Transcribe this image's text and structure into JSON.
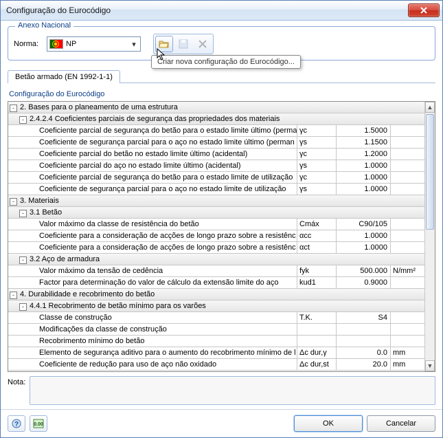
{
  "window": {
    "title": "Configuração do Eurocódigo"
  },
  "annex": {
    "legend": "Anexo Nacional",
    "norm_label": "Norma:",
    "norm_value": "NP",
    "tooltip": "Criar nova configuração do Eurocódigo..."
  },
  "tabs": [
    {
      "label": "Betão armado (EN 1992-1-1)"
    }
  ],
  "tree": {
    "title": "Configuração do Eurocódigo",
    "rows": [
      {
        "type": "section",
        "depth": 0,
        "toggle": "-",
        "label": "2. Bases para o planeamento de uma estrutura"
      },
      {
        "type": "section",
        "depth": 1,
        "toggle": "-",
        "label": "2.4.2.4 Coeficientes parciais de segurança das propriedades dos materiais"
      },
      {
        "type": "value",
        "depth": 2,
        "label": "Coeficiente parcial de segurança do betão para o estado limite último (perma",
        "sym": "γc",
        "val": "1.5000",
        "unit": ""
      },
      {
        "type": "value",
        "depth": 2,
        "label": "Coeficiente de segurança parcial para o aço no estado limite último (perman",
        "sym": "γs",
        "val": "1.1500",
        "unit": ""
      },
      {
        "type": "value",
        "depth": 2,
        "label": "Coeficiente parcial do betão no estado limite último (acidental)",
        "sym": "γc",
        "val": "1.2000",
        "unit": ""
      },
      {
        "type": "value",
        "depth": 2,
        "label": "Coeficiente parcial do aço no estado limite último (acidental)",
        "sym": "γs",
        "val": "1.0000",
        "unit": ""
      },
      {
        "type": "value",
        "depth": 2,
        "label": "Coeficiente parcial de segurança do betão para o estado limite de utilização",
        "sym": "γc",
        "val": "1.0000",
        "unit": ""
      },
      {
        "type": "value",
        "depth": 2,
        "label": "Coeficiente de segurança parcial para o aço no estado limite de utilização",
        "sym": "γs",
        "val": "1.0000",
        "unit": ""
      },
      {
        "type": "section",
        "depth": 0,
        "toggle": "-",
        "label": "3. Materiais"
      },
      {
        "type": "section",
        "depth": 1,
        "toggle": "-",
        "label": "3.1 Betão"
      },
      {
        "type": "value",
        "depth": 2,
        "label": "Valor máximo da classe de resistência do betão",
        "sym": "Cmáx",
        "val": "C90/105",
        "unit": ""
      },
      {
        "type": "value",
        "depth": 2,
        "label": "Coeficiente para a consideração de acções de longo prazo sobre a resistênc",
        "sym": "αcc",
        "val": "1.0000",
        "unit": ""
      },
      {
        "type": "value",
        "depth": 2,
        "label": "Coeficiente para a consideração de acções de longo prazo sobre a resistênc",
        "sym": "αct",
        "val": "1.0000",
        "unit": ""
      },
      {
        "type": "section",
        "depth": 1,
        "toggle": "-",
        "label": "3.2 Aço de armadura"
      },
      {
        "type": "value",
        "depth": 2,
        "label": "Valor máximo da tensão de cedência",
        "sym": "fyk",
        "val": "500.000",
        "unit": "N/mm²"
      },
      {
        "type": "value",
        "depth": 2,
        "label": "Factor para determinação do valor de cálculo da extensão limite do aço",
        "sym": "kud1",
        "val": "0.9000",
        "unit": ""
      },
      {
        "type": "section",
        "depth": 0,
        "toggle": "-",
        "label": "4. Durabilidade e recobrimento do betão"
      },
      {
        "type": "section",
        "depth": 1,
        "toggle": "-",
        "label": "4.4.1 Recobrimento de betão mínimo para os varões"
      },
      {
        "type": "value",
        "depth": 2,
        "label": "Classe de construção",
        "sym": "T.K.",
        "val": "S4",
        "unit": ""
      },
      {
        "type": "value",
        "depth": 2,
        "label": "Modificações da classe de construção",
        "sym": "",
        "val": "",
        "unit": ""
      },
      {
        "type": "value",
        "depth": 2,
        "label": "Recobrimento mínimo do betão",
        "sym": "",
        "val": "",
        "unit": ""
      },
      {
        "type": "value",
        "depth": 2,
        "label": "Elemento de segurança aditivo para o aumento do recobrimento mínimo de l",
        "sym": "Δc dur,γ",
        "val": "0.0",
        "unit": "mm"
      },
      {
        "type": "value",
        "depth": 2,
        "label": "Coeficiente de redução para uso de aço não oxidado",
        "sym": "Δc dur,st",
        "val": "20.0",
        "unit": "mm"
      }
    ]
  },
  "nota_label": "Nota:",
  "buttons": {
    "ok": "OK",
    "cancel": "Cancelar"
  }
}
